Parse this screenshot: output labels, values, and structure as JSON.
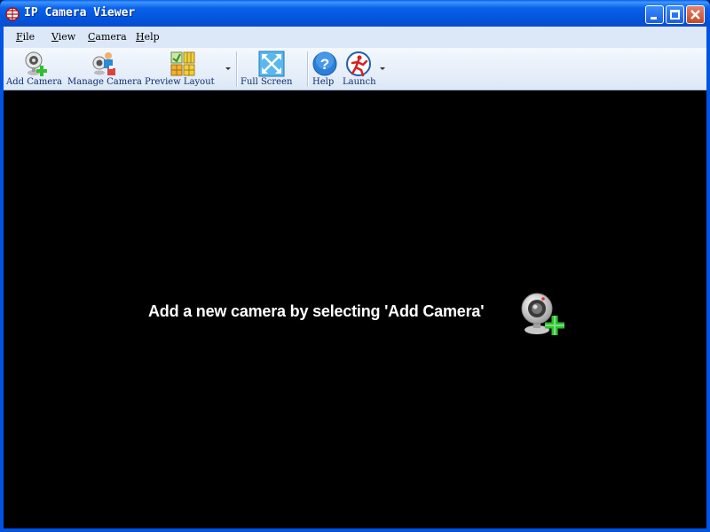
{
  "window": {
    "title": "IP Camera Viewer"
  },
  "menu": [
    {
      "mnemonic": "F",
      "rest": "ile"
    },
    {
      "mnemonic": "V",
      "rest": "iew"
    },
    {
      "mnemonic": "C",
      "rest": "amera"
    },
    {
      "mnemonic": "H",
      "rest": "elp"
    }
  ],
  "toolbar": {
    "add_camera": "Add Camera",
    "manage_camera": "Manage Camera",
    "preview_layout": "Preview Layout",
    "full_screen": "Full Screen",
    "help": "Help",
    "launch": "Launch"
  },
  "icons": {
    "app": "app-globe-icon",
    "add_camera": "webcam-add-icon",
    "manage_camera": "manage-camera-icon",
    "preview_layout": "grid-layout-icon",
    "full_screen": "fullscreen-icon",
    "help": "help-icon",
    "launch": "launch-icon"
  },
  "main": {
    "message": "Add a new camera by selecting 'Add Camera'"
  },
  "colors": {
    "title_bar": "#0355dc",
    "menu_bar": "#dce8f8",
    "viewport": "#000000",
    "accent_green": "#2fbf2f"
  }
}
